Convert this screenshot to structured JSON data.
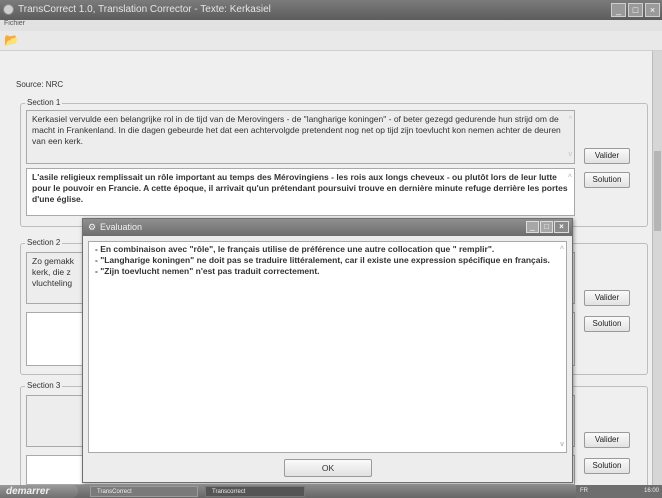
{
  "window": {
    "title": "TransCorrect 1.0, Translation Corrector - Texte: Kerkasiel"
  },
  "menu": {
    "fichier": "Fichier"
  },
  "source_label": "Source: NRC",
  "sections": [
    {
      "label": "Section 1",
      "source_text": "Kerkasiel vervulde een belangrijke rol in de tijd van de Merovingers - de \"langharige koningen\" - of beter gezegd gedurende hun strijd om de macht in Frankenland. In die dagen gebeurde het dat een achtervolgde pretendent nog net op tijd zijn toevlucht kon nemen achter de deuren van een kerk.",
      "translation_text": "L'asile religieux remplissait un rôle important au temps des Mérovingiens - les rois aux longs cheveux - ou plutôt lors de leur lutte pour le pouvoir en Francie. A cette époque, il arrivait qu'un prétendant poursuivi trouve en dernière minute refuge derrière les portes d'une église.",
      "valider": "Valider",
      "solution": "Solution"
    },
    {
      "label": "Section 2",
      "source_text": "Zo gemakkelijk ging het echter niet. Wie toevlucht zocht in een kerk, die z... vluchteling...",
      "source_visible_lines": [
        "Zo gemakk",
        "kerk, die z",
        "vluchteling"
      ],
      "translation_text": "",
      "valider": "Valider",
      "solution": "Solution"
    },
    {
      "label": "Section 3",
      "source_text": "",
      "translation_text": "",
      "valider": "Valider",
      "solution": "Solution"
    }
  ],
  "evaluation": {
    "title": "Evaluation",
    "lines": [
      "- En combinaison avec \"rôle\", le français utilise de préférence une autre collocation  que \" remplir\".",
      "- \"Langharige koningen\" ne doit pas se traduire littéralement, car il existe une expression spécifique en français.",
      "- \"Zijn toevlucht nemen\" n'est pas traduit correctement."
    ],
    "ok": "OK"
  },
  "taskbar": {
    "start": "demarrer",
    "tasks": [
      "TransCorrect",
      "Transcorrect"
    ],
    "lang": "FR",
    "clock": "16:00"
  },
  "colors": {
    "titlebar": "#6a6a6a",
    "client": "#efefef",
    "textbox": "#ffffff"
  }
}
